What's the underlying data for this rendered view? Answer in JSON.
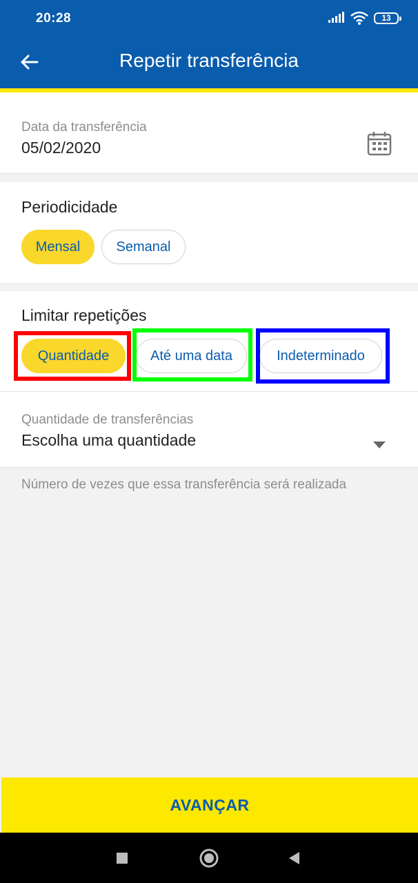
{
  "status_bar": {
    "time": "20:28",
    "battery": "13"
  },
  "app_bar": {
    "title": "Repetir transferência",
    "back_icon": "arrow-left-icon"
  },
  "date_field": {
    "label": "Data da transferência",
    "value": "05/02/2020",
    "icon": "calendar-icon"
  },
  "periodicity": {
    "title": "Periodicidade",
    "options": [
      {
        "label": "Mensal",
        "selected": true
      },
      {
        "label": "Semanal",
        "selected": false
      }
    ]
  },
  "limit": {
    "title": "Limitar repetições",
    "options": [
      {
        "label": "Quantidade",
        "selected": true,
        "highlight": "#ff0000"
      },
      {
        "label": "Até uma data",
        "selected": false,
        "highlight": "#00ff00"
      },
      {
        "label": "Indeterminado",
        "selected": false,
        "highlight": "#0000ff"
      }
    ]
  },
  "quantity_field": {
    "label": "Quantidade de transferências",
    "value": "Escolha uma quantidade",
    "icon": "dropdown-arrow-icon"
  },
  "helper_text": "Número de vezes que essa transferência será realizada",
  "cta": {
    "label": "AVANÇAR"
  },
  "colors": {
    "primary": "#0a5cad",
    "accent_yellow": "#fde800",
    "chip_selected": "#fad72b"
  }
}
